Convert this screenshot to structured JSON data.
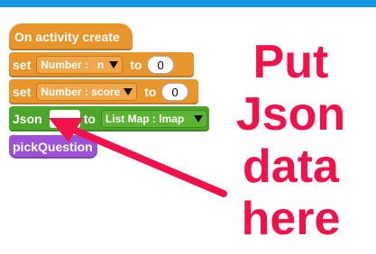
{
  "blocks": {
    "hat": "On activity create",
    "set1": {
      "kw": "set",
      "dropdown": "Number :   n",
      "to": "to",
      "value": "0"
    },
    "set2": {
      "kw": "set",
      "dropdown": "Number : score",
      "to": "to",
      "value": "0"
    },
    "json": {
      "kw": "Json",
      "to": "to",
      "dropdown": "List Map : lmap"
    },
    "pick": "pickQuestion"
  },
  "annotation": {
    "line1": "Put",
    "line2": "Json",
    "line3": "data",
    "line4": "here",
    "color": "#f2114a"
  },
  "colors": {
    "topbar": "#1196e0",
    "event_block": "#e8952c",
    "json_block": "#4ea52c",
    "procedure_block": "#9b52d9"
  }
}
